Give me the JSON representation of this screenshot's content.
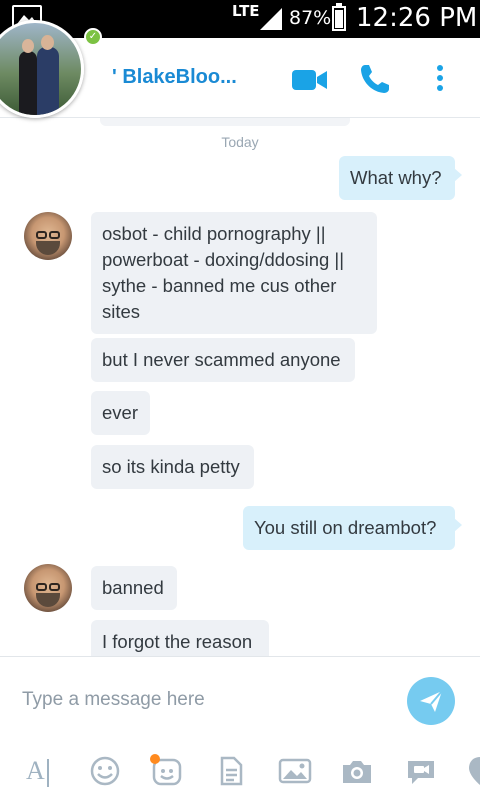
{
  "status_bar": {
    "network": "LTE",
    "battery": "87%",
    "time": "12:26 PM"
  },
  "header": {
    "contact_name": "' BlakeBloo...",
    "online": true
  },
  "chat": {
    "cut_off_text": "",
    "date_separator": "Today",
    "messages": [
      {
        "direction": "out",
        "text": "What why?"
      },
      {
        "direction": "in",
        "text": "osbot - child pornography || powerboat - doxing/ddosing || sythe - banned me cus other sites"
      },
      {
        "direction": "in",
        "text": "but I never scammed anyone"
      },
      {
        "direction": "in",
        "text": "ever"
      },
      {
        "direction": "in",
        "text": "so its kinda petty"
      },
      {
        "direction": "out",
        "text": "You still on dreambot?"
      },
      {
        "direction": "in",
        "text": "banned"
      },
      {
        "direction": "in",
        "text": "I forgot the reason"
      }
    ]
  },
  "composer": {
    "placeholder": "Type a message here",
    "value": ""
  },
  "toolbar": {
    "icons": [
      "font-icon",
      "emoticon-icon",
      "moji-icon",
      "file-icon",
      "photo-icon",
      "camera-icon",
      "video-message-icon",
      "location-icon"
    ]
  },
  "colors": {
    "brand": "#1aa3e6",
    "incoming_bubble": "#eef1f5",
    "outgoing_bubble": "#d8f0fb",
    "online": "#7cc243",
    "notification": "#ff8a1e"
  }
}
